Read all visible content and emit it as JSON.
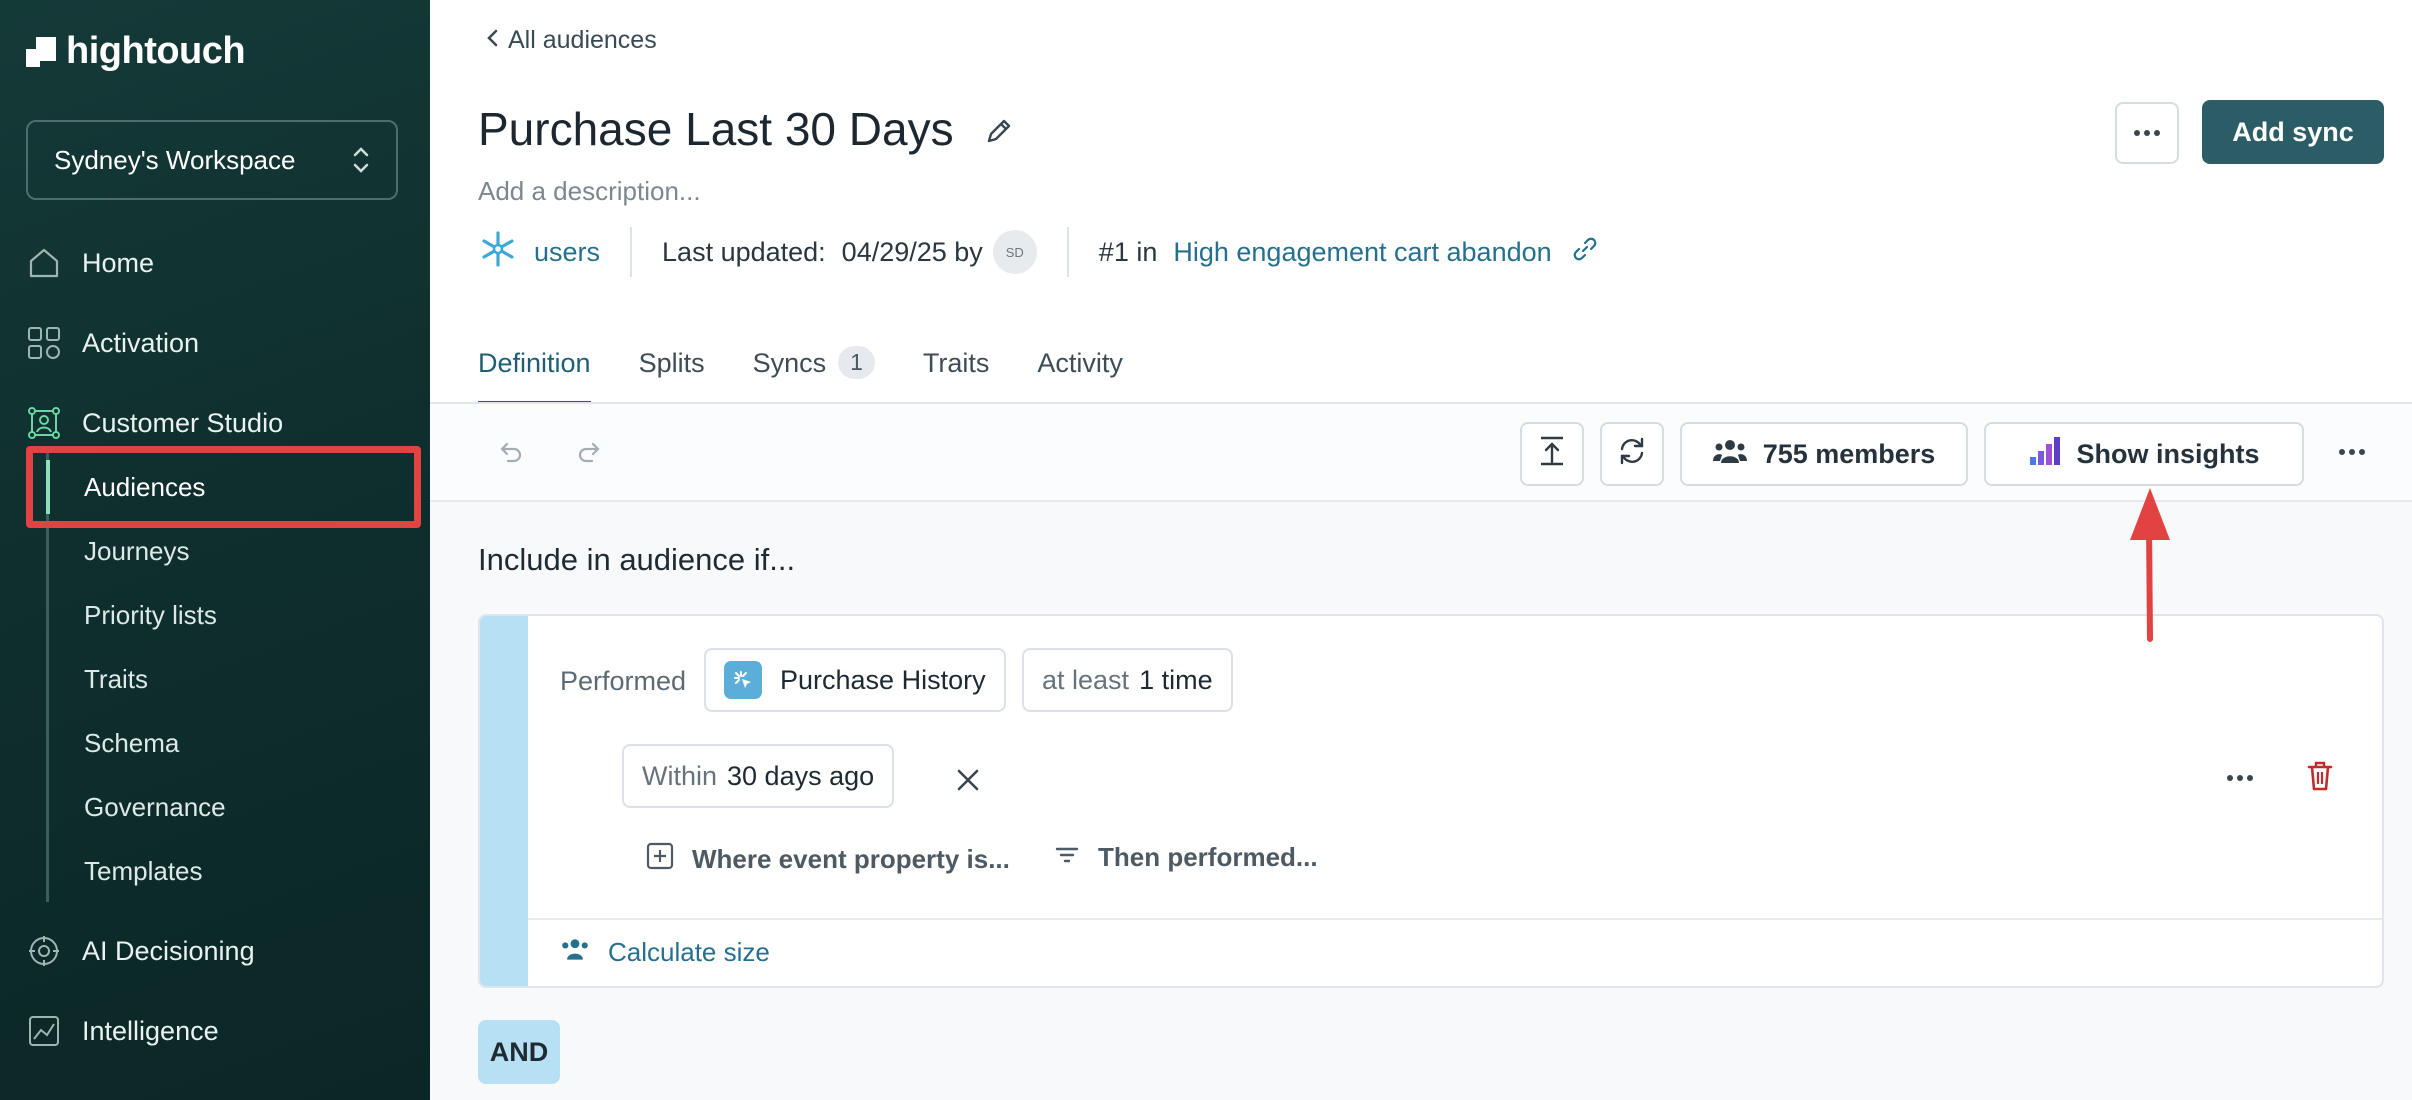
{
  "brand": {
    "name": "hightouch"
  },
  "workspace": {
    "name": "Sydney's Workspace"
  },
  "sidebar": {
    "items": [
      {
        "label": "Home",
        "icon": "home-icon"
      },
      {
        "label": "Activation",
        "icon": "activation-icon"
      },
      {
        "label": "Customer Studio",
        "icon": "customer-studio-icon"
      },
      {
        "label": "AI Decisioning",
        "icon": "ai-decisioning-icon"
      },
      {
        "label": "Intelligence",
        "icon": "intelligence-icon"
      }
    ],
    "sub_items": [
      "Audiences",
      "Journeys",
      "Priority lists",
      "Traits",
      "Schema",
      "Governance",
      "Templates"
    ],
    "active_sub_item": "Audiences"
  },
  "header": {
    "back_label": "All audiences",
    "title": "Purchase Last 30 Days",
    "description_placeholder": "Add a description...",
    "source": "users",
    "last_updated_label": "Last updated:",
    "last_updated_value": "04/29/25 by",
    "avatar_initials": "SD",
    "rank_label": "#1 in",
    "rank_link": "High engagement cart abandon",
    "add_sync_label": "Add sync"
  },
  "tabs": [
    {
      "label": "Definition",
      "active": true
    },
    {
      "label": "Splits"
    },
    {
      "label": "Syncs",
      "badge": "1"
    },
    {
      "label": "Traits"
    },
    {
      "label": "Activity"
    }
  ],
  "toolbar": {
    "members_label": "755 members",
    "insights_label": "Show insights"
  },
  "definition": {
    "include_label": "Include in audience if...",
    "condition": {
      "performed_label": "Performed",
      "event_name": "Purchase History",
      "frequency_prefix": "at least",
      "frequency_value": "1 time",
      "within_prefix": "Within",
      "within_value": "30 days ago",
      "where_label": "Where event property is...",
      "then_label": "Then performed...",
      "calc_label": "Calculate size"
    },
    "and_label": "AND"
  },
  "colors": {
    "sidebar_bg": "#0f2f2e",
    "accent": "#2c5d66",
    "link": "#25708f",
    "highlight": "#e34242",
    "condition_stripe": "#b7e0f5"
  }
}
